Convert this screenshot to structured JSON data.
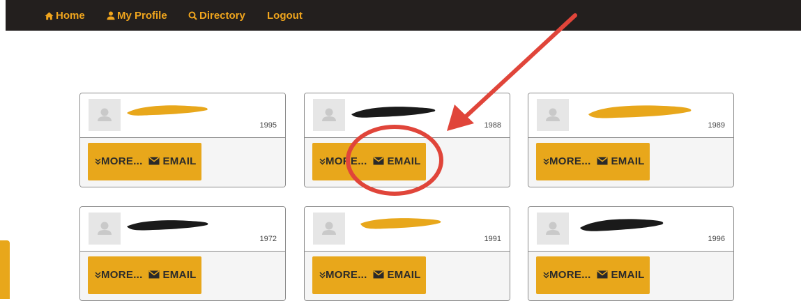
{
  "nav": {
    "home": "Home",
    "profile": "My Profile",
    "directory": "Directory",
    "logout": "Logout"
  },
  "cards": [
    {
      "name": "",
      "year": "1995",
      "more": "MORE...",
      "email": "EMAIL"
    },
    {
      "name": "",
      "year": "1988",
      "more": "MORE...",
      "email": "EMAIL"
    },
    {
      "name": "",
      "year": "1989",
      "more": "MORE...",
      "email": "EMAIL"
    },
    {
      "name": "",
      "year": "1972",
      "more": "MORE...",
      "email": "EMAIL"
    },
    {
      "name": "",
      "year": "1991",
      "more": "MORE...",
      "email": "EMAIL"
    },
    {
      "name": "",
      "year": "1996",
      "more": "MORE...",
      "email": "EMAIL"
    }
  ],
  "colors": {
    "nav_bg": "#231f1e",
    "nav_text": "#f0a51d",
    "button": "#e8a71b",
    "annotation": "#e0453a"
  },
  "icons": [
    "home-icon",
    "user-icon",
    "search-icon",
    "double-chevron-down-icon",
    "envelope-icon"
  ]
}
